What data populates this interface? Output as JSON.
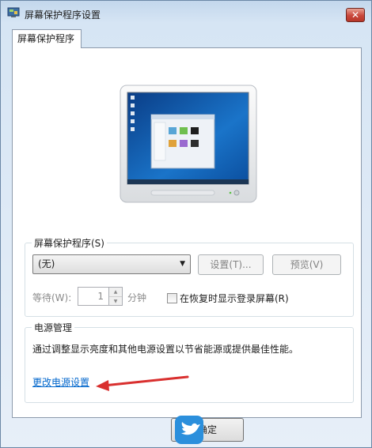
{
  "window": {
    "title": "屏幕保护程序设置",
    "close_label": "✕"
  },
  "tab": {
    "label": "屏幕保护程序"
  },
  "screensaver": {
    "group_label": "屏幕保护程序(S)",
    "selected": "(无)",
    "settings_label": "设置(T)...",
    "preview_label": "预览(V)",
    "wait_label": "等待(W):",
    "wait_value": "1",
    "minutes_label": "分钟",
    "resume_checkbox_label": "在恢复时显示登录屏幕(R)",
    "resume_checked": false
  },
  "power": {
    "group_label": "电源管理",
    "description": "通过调整显示亮度和其他电源设置以节省能源或提供最佳性能。",
    "link_label": "更改电源设置"
  },
  "footer": {
    "ok_label": "确定"
  },
  "colors": {
    "accent_link": "#0066cc",
    "annotation_arrow": "#d9302f"
  }
}
